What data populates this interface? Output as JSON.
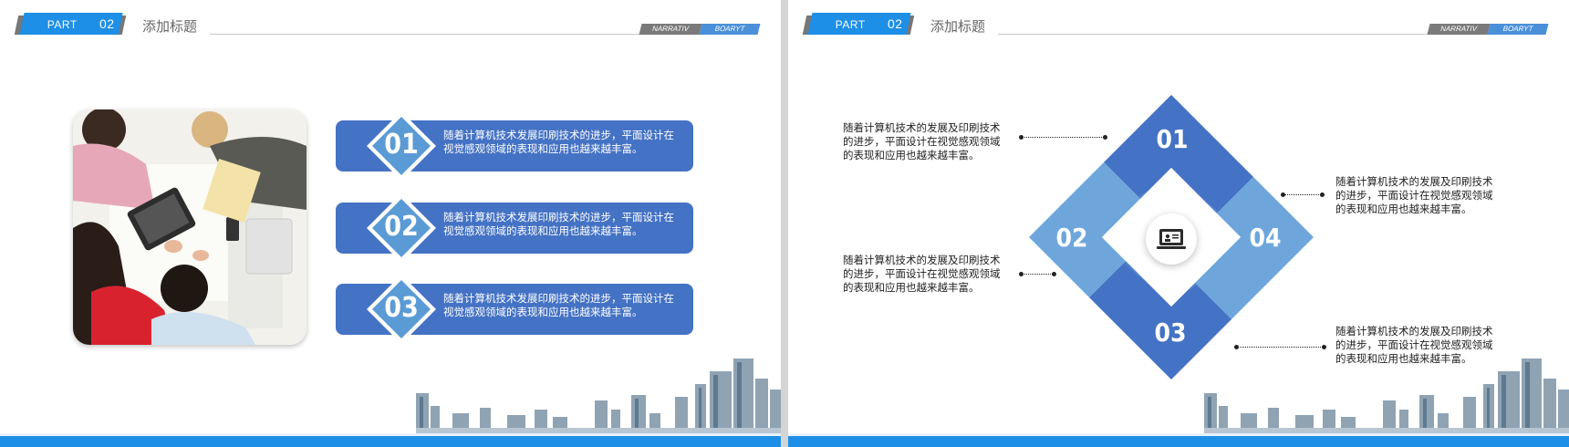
{
  "left_slide": {
    "part_label": "PART",
    "part_number": "02",
    "title": "添加标题",
    "tag_dark": "NARRATIV",
    "tag_blue": "BOARYT",
    "items": [
      {
        "number": "01",
        "text": "随着计算机技术发展印刷技术的进步，平面设计在视觉感观领域的表现和应用也越来越丰富。"
      },
      {
        "number": "02",
        "text": "随着计算机技术发展印刷技术的进步，平面设计在视觉感观领域的表现和应用也越来越丰富。"
      },
      {
        "number": "03",
        "text": "随着计算机技术发展印刷技术的进步，平面设计在视觉感观领域的表现和应用也越来越丰富。"
      }
    ]
  },
  "right_slide": {
    "part_label": "PART",
    "part_number": "02",
    "title": "添加标题",
    "tag_dark": "NARRATIV",
    "tag_blue": "BOARYT",
    "diamond_labels": [
      "01",
      "02",
      "03",
      "04"
    ],
    "descriptions": {
      "top_left": "随着计算机技术的发展及印刷技术的进步，平面设计在视觉感观领域的表现和应用也越来越丰富。",
      "middle_left": "随着计算机技术的发展及印刷技术的进步，平面设计在视觉感观领域的表现和应用也越来越丰富。",
      "top_right": "随着计算机技术的发展及印刷技术的进步，平面设计在视觉感观领域的表现和应用也越来越丰富。",
      "bottom_right": "随着计算机技术的发展及印刷技术的进步，平面设计在视觉感观领域的表现和应用也越来越丰富。"
    },
    "center_icon": "computer-user-icon"
  },
  "colors": {
    "accent": "#1e8fe6",
    "item_bar": "#4472c4",
    "diamond_dark": "#4472c4",
    "diamond_light": "#6ea6dc"
  }
}
